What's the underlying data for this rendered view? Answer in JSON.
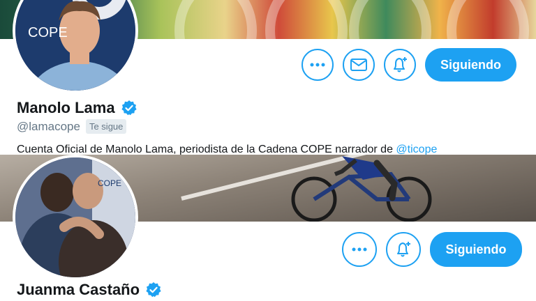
{
  "profiles": [
    {
      "name": "Manolo Lama",
      "handle": "@lamacope",
      "follows_you_badge": "Te sigue",
      "bio_text": "Cuenta Oficial de Manolo Lama, periodista de la Cadena COPE narrador de ",
      "bio_mention": "@ticope",
      "avatar_logo_text": "COPE",
      "follow_label": "Siguiendo",
      "verified": true,
      "actions": [
        "more-options-icon",
        "message-icon",
        "notifications-add-icon"
      ]
    },
    {
      "name": "Juanma Castaño",
      "follow_label": "Siguiendo",
      "avatar_logo_text": "COPE",
      "verified": true,
      "actions": [
        "more-options-icon",
        "notifications-add-icon"
      ]
    }
  ],
  "colors": {
    "accent": "#1da1f2",
    "text": "#14171a",
    "secondary_text": "#657786",
    "badge_bg": "#e6ecf0"
  }
}
